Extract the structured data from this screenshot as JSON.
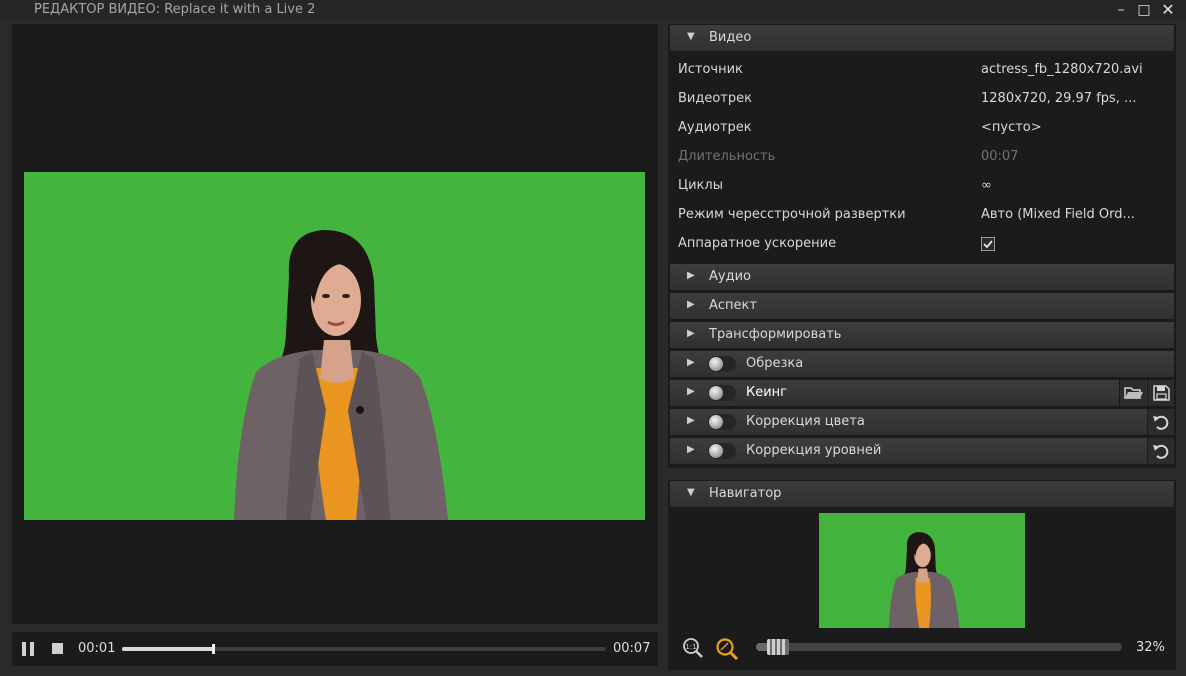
{
  "window": {
    "title": "РЕДАКТОР ВИДЕО: Replace it with a Live 2",
    "buttons": {
      "minimize": "–",
      "maximize": "□",
      "close": "✕"
    }
  },
  "player": {
    "current_time": "00:01",
    "end_time": "00:07",
    "progress": 0.19,
    "state": "playing",
    "background_color": "#43b43e"
  },
  "video_section": {
    "label": "Видео",
    "expanded": true,
    "properties": [
      {
        "label": "Источник",
        "value": "actress_fb_1280x720.avi",
        "disabled": false
      },
      {
        "label": "Видеотрек",
        "value": "1280x720, 29.97 fps, ...",
        "disabled": false
      },
      {
        "label": "Аудиотрек",
        "value": "<пусто>",
        "disabled": false
      },
      {
        "label": "Длительность",
        "value": "00:07",
        "disabled": true
      },
      {
        "label": "Циклы",
        "value": "∞",
        "disabled": false
      },
      {
        "label": "Режим чересстрочной развертки",
        "value": "Авто (Mixed Field Ord...",
        "disabled": false
      },
      {
        "label": "Аппаратное ускорение",
        "checked": true,
        "disabled": false
      }
    ]
  },
  "sections": [
    {
      "label": "Аудио",
      "toggle": false
    },
    {
      "label": "Аспект",
      "toggle": false
    },
    {
      "label": "Трансформировать",
      "toggle": false
    },
    {
      "label": "Обрезка",
      "toggle": true
    },
    {
      "label": "Кеинг",
      "toggle": true,
      "actions": [
        "folder-open-icon",
        "save-icon"
      ]
    },
    {
      "label": "Коррекция цвета",
      "toggle": true,
      "actions": [
        "reset-icon"
      ]
    },
    {
      "label": "Коррекция уровней",
      "toggle": true,
      "actions": [
        "reset-icon"
      ]
    }
  ],
  "navigator": {
    "label": "Навигатор",
    "expanded": true,
    "zoom_percent": "32%",
    "zoom_level": 0.04
  },
  "colors": {
    "green_screen": "#43b43e",
    "accent_zoom": "#e5a21c"
  }
}
